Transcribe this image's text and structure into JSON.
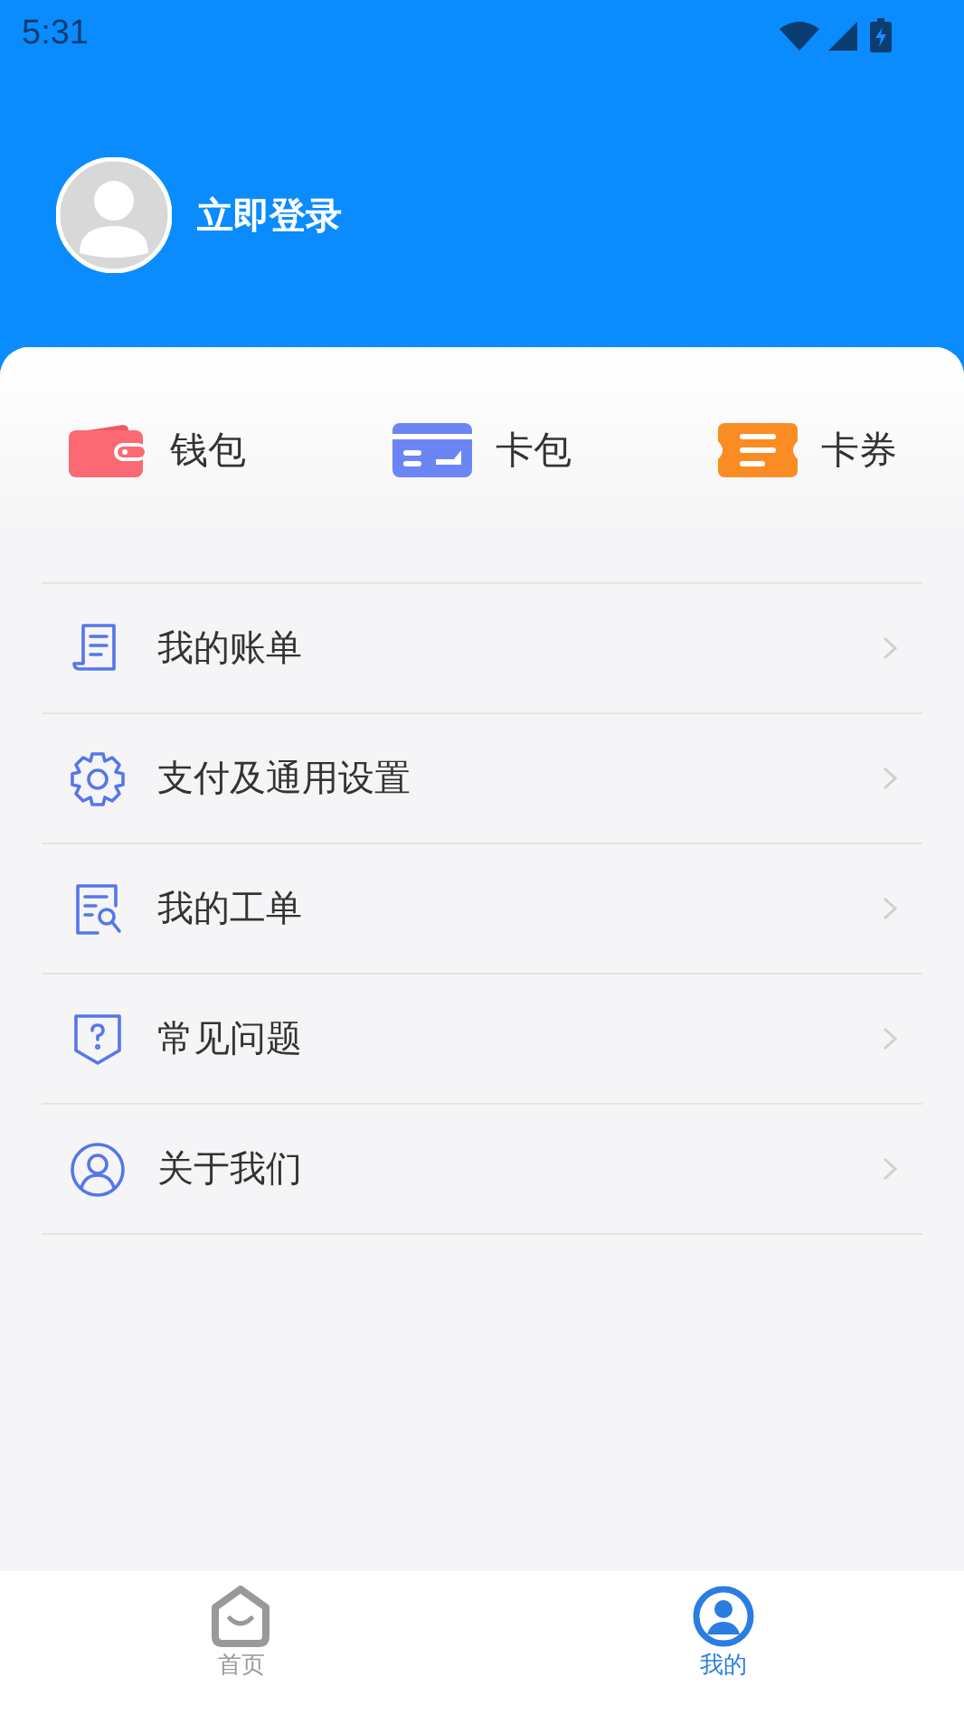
{
  "status_bar": {
    "time": "5:31"
  },
  "profile": {
    "login_label": "立即登录"
  },
  "shortcuts": [
    {
      "kind": "wallet",
      "label": "钱包"
    },
    {
      "kind": "card",
      "label": "卡包"
    },
    {
      "kind": "coupon",
      "label": "卡券"
    }
  ],
  "menu": [
    {
      "kind": "bill",
      "label": "我的账单"
    },
    {
      "kind": "settings",
      "label": "支付及通用设置"
    },
    {
      "kind": "ticket",
      "label": "我的工单"
    },
    {
      "kind": "faq",
      "label": "常见问题"
    },
    {
      "kind": "about",
      "label": "关于我们"
    }
  ],
  "tab_bar": [
    {
      "kind": "home",
      "label": "首页",
      "selected": false
    },
    {
      "kind": "me",
      "label": "我的",
      "selected": true
    }
  ]
}
